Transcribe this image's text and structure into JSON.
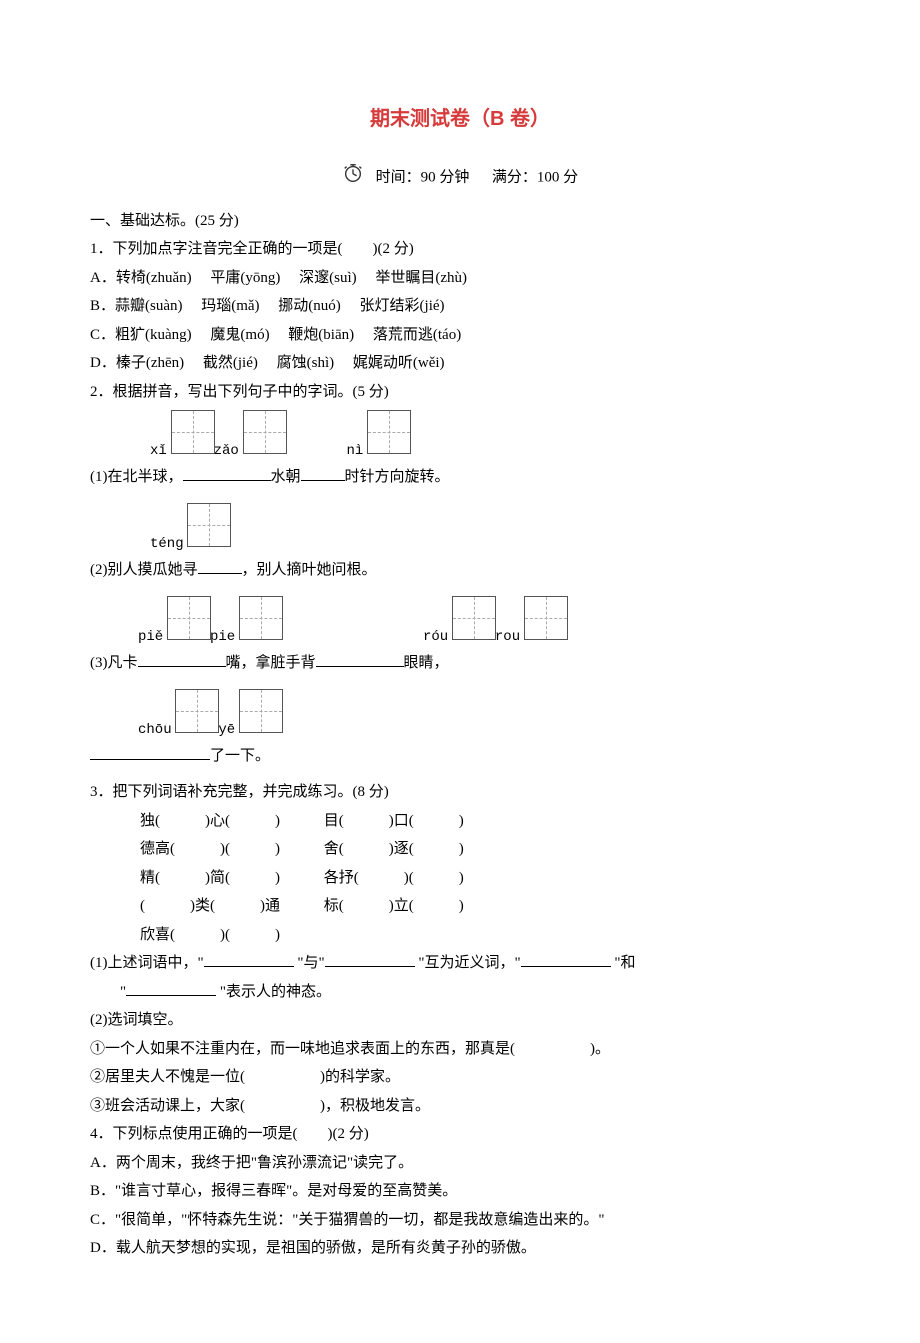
{
  "title": "期末测试卷（B 卷）",
  "meta": {
    "time_label": "时间：90 分钟",
    "score_label": "满分：100 分"
  },
  "sec1": {
    "heading": "一、基础达标。(25 分)",
    "q1": {
      "stem": "1．下列加点字注音完全正确的一项是(　　)(2 分)",
      "A": "A．转椅(zhuǎn)　 平庸(yōng)　 深邃(suì)　 举世瞩目(zhù)",
      "B": "B．蒜瓣(suàn)　 玛瑙(mǎ)　 挪动(nuó)　 张灯结彩(jié)",
      "C": "C．粗犷(kuàng)　 魔鬼(mó)　 鞭炮(biān)　 落荒而逃(táo)",
      "D": "D．榛子(zhēn)　 截然(jié)　 腐蚀(shì)　 娓娓动听(wěi)"
    },
    "q2": {
      "stem": "2．根据拼音，写出下列句子中的字词。(5 分)",
      "item1": {
        "py1": "xǐ",
        "py2": "zǎo",
        "py3": "nì",
        "pre": "(1)在北半球，",
        "mid1": "水朝",
        "mid2": "时针方向旋转。"
      },
      "item2": {
        "py1": "téng",
        "pre": "(2)别人摸瓜她寻",
        "post": "，别人摘叶她问根。"
      },
      "item3": {
        "py1": "piě",
        "py2": "pie",
        "py3": "róu",
        "py4": "rou",
        "pre": "(3)凡卡",
        "mid1": "嘴，拿脏手背",
        "mid2": "眼睛，",
        "py5": "chōu",
        "py6": "yē",
        "post": "了一下。"
      }
    },
    "q3": {
      "stem": "3．把下列词语补充完整，并完成练习。(8 分)",
      "rows": [
        [
          "独(　　　)心(　　　)",
          "目(　　　)口(　　　)"
        ],
        [
          "德高(　　　)(　　　)",
          "舍(　　　)逐(　　　)"
        ],
        [
          "精(　　　)简(　　　)",
          "各抒(　　　)(　　　)"
        ],
        [
          "(　　　)类(　　　)通",
          "标(　　　)立(　　　)"
        ],
        [
          "欣喜(　　　)(　　　)",
          ""
        ]
      ],
      "sub1a": "(1)上述词语中，\"",
      "sub1b": "\"与\"",
      "sub1c": "\"互为近义词，\"",
      "sub1d": "\"和",
      "sub1e": "\"",
      "sub1f": "\"表示人的神态。",
      "sub2": "(2)选词填空。",
      "s2_1": "①一个人如果不注重内在，而一味地追求表面上的东西，那真是(　　　　　)。",
      "s2_2": "②居里夫人不愧是一位(　　　　　)的科学家。",
      "s2_3": "③班会活动课上，大家(　　　　　)，积极地发言。"
    },
    "q4": {
      "stem": "4．下列标点使用正确的一项是(　　)(2 分)",
      "A": "A．两个周末，我终于把\"鲁滨孙漂流记\"读完了。",
      "B": "B．\"谁言寸草心，报得三春晖\"。是对母爱的至高赞美。",
      "C": "C．\"很简单，\"怀特森先生说：\"关于猫猬兽的一切，都是我故意编造出来的。\"",
      "D": "D．载人航天梦想的实现，是祖国的骄傲，是所有炎黄子孙的骄傲。"
    }
  }
}
